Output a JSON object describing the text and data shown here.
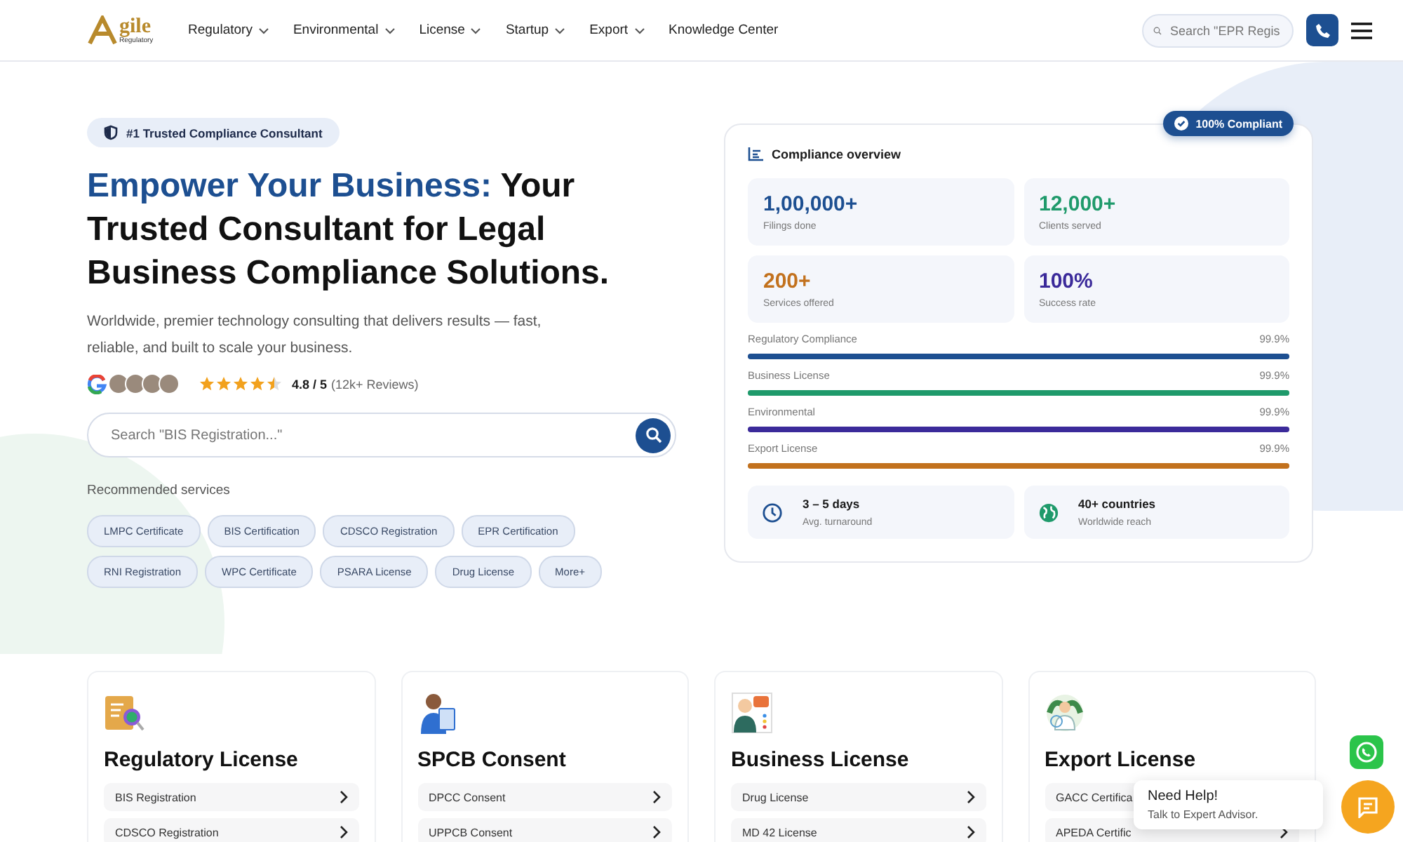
{
  "header": {
    "logo": {
      "word": "gile",
      "tagline": "Regulatory"
    },
    "nav": [
      {
        "label": "Regulatory",
        "dropdown": true
      },
      {
        "label": "Environmental",
        "dropdown": true
      },
      {
        "label": "License",
        "dropdown": true
      },
      {
        "label": "Startup",
        "dropdown": true
      },
      {
        "label": "Export",
        "dropdown": true
      },
      {
        "label": "Knowledge Center",
        "dropdown": false
      }
    ],
    "search": {
      "placeholder": "Search \"EPR Regis"
    }
  },
  "hero": {
    "badge": "#1 Trusted Compliance Consultant",
    "title_highlight": "Empower Your Business:",
    "title_rest": "Your Trusted Consultant for Legal Business Compliance Solutions.",
    "subtitle": "Worldwide, premier technology consulting that delivers results — fast, reliable, and built to scale your business.",
    "rating": {
      "stars": 4.5,
      "score": "4.8 / 5",
      "reviews": "(12k+ Reviews)"
    },
    "search": {
      "placeholder": "Search \"BIS Registration...\""
    },
    "recommended_label": "Recommended services",
    "chips": [
      "LMPC Certificate",
      "BIS Certification",
      "CDSCO Registration",
      "EPR Certification",
      "RNI Registration",
      "WPC Certificate",
      "PSARA License",
      "Drug License",
      "More+"
    ]
  },
  "overview": {
    "badge": "100% Compliant",
    "title": "Compliance overview",
    "stats": [
      {
        "value": "1,00,000+",
        "label": "Filings done",
        "color": "#1d4f91"
      },
      {
        "value": "12,000+",
        "label": "Clients served",
        "color": "#1f9a6b"
      },
      {
        "value": "200+",
        "label": "Services offered",
        "color": "#c2711d"
      },
      {
        "value": "100%",
        "label": "Success rate",
        "color": "#3b2a9a"
      }
    ],
    "bars": [
      {
        "name": "Regulatory Compliance",
        "reading": "99.9%",
        "level": 0.999,
        "color": "#1d4f91"
      },
      {
        "name": "Business License",
        "reading": "99.9%",
        "level": 0.999,
        "color": "#1f9a6b"
      },
      {
        "name": "Environmental",
        "reading": "99.9%",
        "level": 0.999,
        "color": "#3b2a9a"
      },
      {
        "name": "Export License",
        "reading": "99.9%",
        "level": 0.999,
        "color": "#c2711d"
      }
    ],
    "facts": [
      {
        "kind": "clock",
        "title": "3 – 5 days",
        "label": "Avg. turnaround"
      },
      {
        "kind": "globe",
        "title": "40+ countries",
        "label": "Worldwide reach"
      }
    ]
  },
  "cards": [
    {
      "kind": "document",
      "title": "Regulatory License",
      "items": [
        "BIS Registration",
        "CDSCO Registration"
      ]
    },
    {
      "kind": "person",
      "title": "SPCB Consent",
      "items": [
        "DPCC Consent",
        "UPPCB Consent"
      ]
    },
    {
      "kind": "advisor",
      "title": "Business License",
      "items": [
        "Drug License",
        "MD 42 License"
      ]
    },
    {
      "kind": "plant",
      "title": "Export License",
      "items": [
        "GACC Certifica",
        "APEDA Certific"
      ]
    }
  ],
  "help": {
    "title": "Need Help!",
    "subtitle": "Talk to Expert Advisor."
  }
}
